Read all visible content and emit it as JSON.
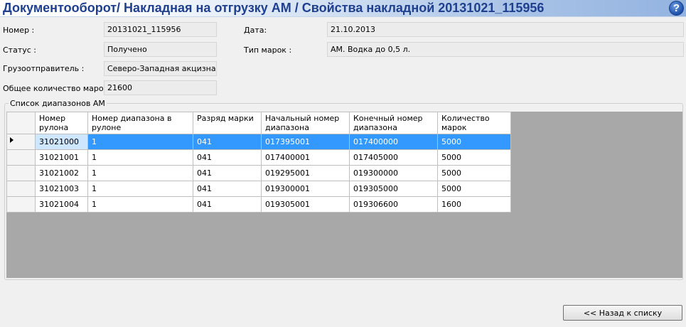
{
  "header": {
    "title": "Документооборот/ Накладная на отгрузку АМ / Свойства накладной 20131021_115956",
    "help_symbol": "?"
  },
  "fields": {
    "number_label": "Номер :",
    "number_value": "20131021_115956",
    "date_label": "Дата:",
    "date_value": "21.10.2013",
    "status_label": "Статус :",
    "status_value": "Получено",
    "stamp_type_label": "Тип марок :",
    "stamp_type_value": "АМ. Водка до 0,5 л.",
    "shipper_label": "Грузоотправитель :",
    "shipper_value": "Северо-Западная акцизная та",
    "total_label": "Общее количество марок :",
    "total_value": "21600"
  },
  "ranges": {
    "caption": "Список диапазонов АМ",
    "columns": [
      "Номер рулона",
      "Номер диапазона в рулоне",
      "Разряд марки",
      "Начальный номер диапазона",
      "Конечный номер диапазона",
      "Количество марок"
    ],
    "rows": [
      [
        "31021000",
        "1",
        "041",
        "017395001",
        "017400000",
        "5000"
      ],
      [
        "31021001",
        "1",
        "041",
        "017400001",
        "017405000",
        "5000"
      ],
      [
        "31021002",
        "1",
        "041",
        "019295001",
        "019300000",
        "5000"
      ],
      [
        "31021003",
        "1",
        "041",
        "019300001",
        "019305000",
        "5000"
      ],
      [
        "31021004",
        "1",
        "041",
        "019305001",
        "019306600",
        "1600"
      ]
    ],
    "selected_row": 0
  },
  "footer": {
    "back_label": "<< Назад к списку"
  }
}
